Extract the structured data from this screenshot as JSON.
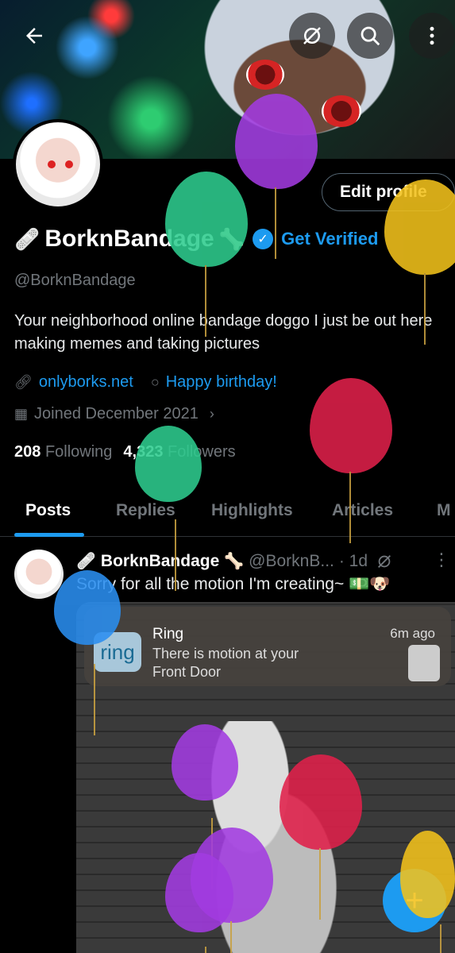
{
  "header": {
    "back_icon": "arrow-left-icon",
    "topbar_icons": [
      "no-signal-icon",
      "search-icon",
      "more-vertical-icon"
    ],
    "edit_profile_label": "Edit profile"
  },
  "profile": {
    "display_name": "BorknBandage",
    "name_prefix_emoji": "🩹",
    "name_suffix_emoji": "🦴",
    "get_verified_label": "Get Verified",
    "handle": "@BorknBandage",
    "bio": "Your neighborhood online bandage doggo  I just be out here making memes and taking pictures",
    "website": "onlyborks.net",
    "birthday": "Happy birthday!",
    "joined": "Joined December 2021",
    "following_count": "208",
    "following_label": "Following",
    "followers_count": "4,323",
    "followers_label": "Followers"
  },
  "tabs": [
    "Posts",
    "Replies",
    "Highlights",
    "Articles",
    "M"
  ],
  "post": {
    "display_name": "BorknBandage",
    "handle": "@BorknB...",
    "time": "· 1d",
    "text": "Sorry for all the motion I'm creating~ 💵🐶",
    "notification": {
      "logo_text": "ring",
      "app": "Ring",
      "time": "6m ago",
      "line1": "There is motion at your",
      "line2": "Front Door"
    }
  },
  "fab_label": "+",
  "colors": {
    "accent": "#1d9bf0",
    "balloon_green": "#2ecc8e",
    "balloon_purple": "#a23be0",
    "balloon_yellow": "#f2c21b",
    "balloon_red": "#e0204a",
    "balloon_blue": "#2a8ef0"
  }
}
